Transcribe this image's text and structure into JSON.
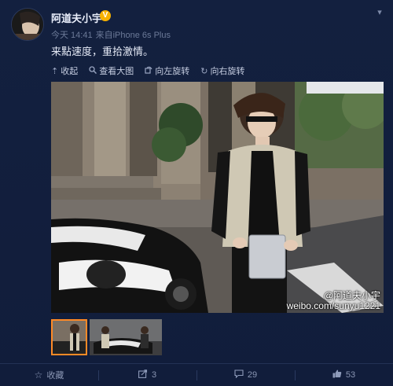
{
  "post": {
    "username": "阿道夫小宇",
    "verified_badge": "V",
    "time": "今天 14:41",
    "source_prefix": "来自",
    "source": "iPhone 6s Plus",
    "text": "来點速度，重拾激情。"
  },
  "toolbar": {
    "collapse": "收起",
    "view_large": "查看大图",
    "rotate_left": "向左旋转",
    "rotate_right": "向右旋转"
  },
  "photo": {
    "watermark_name": "@阿道夫小宇",
    "watermark_url": "weibo.com/sunyu1221"
  },
  "thumbnails": [
    {
      "label": "thumbnail 1",
      "selected": true
    },
    {
      "label": "thumbnail 2",
      "selected": false
    }
  ],
  "footer": {
    "favorite": "收藏",
    "repost_count": "3",
    "comment_count": "29",
    "like_count": "53"
  },
  "icons": {
    "collapse": "arrow-up-icon",
    "view_large": "magnifier-icon",
    "rotate_left": "rotate-left-icon",
    "rotate_right": "rotate-right-icon",
    "favorite": "star-icon",
    "repost": "share-icon",
    "comment": "comment-icon",
    "like": "thumbs-up-icon",
    "menu": "chevron-down-icon"
  },
  "colors": {
    "background": "#0f1c3a",
    "badge": "#f6b100",
    "thumb_selected": "#ff8a26"
  }
}
